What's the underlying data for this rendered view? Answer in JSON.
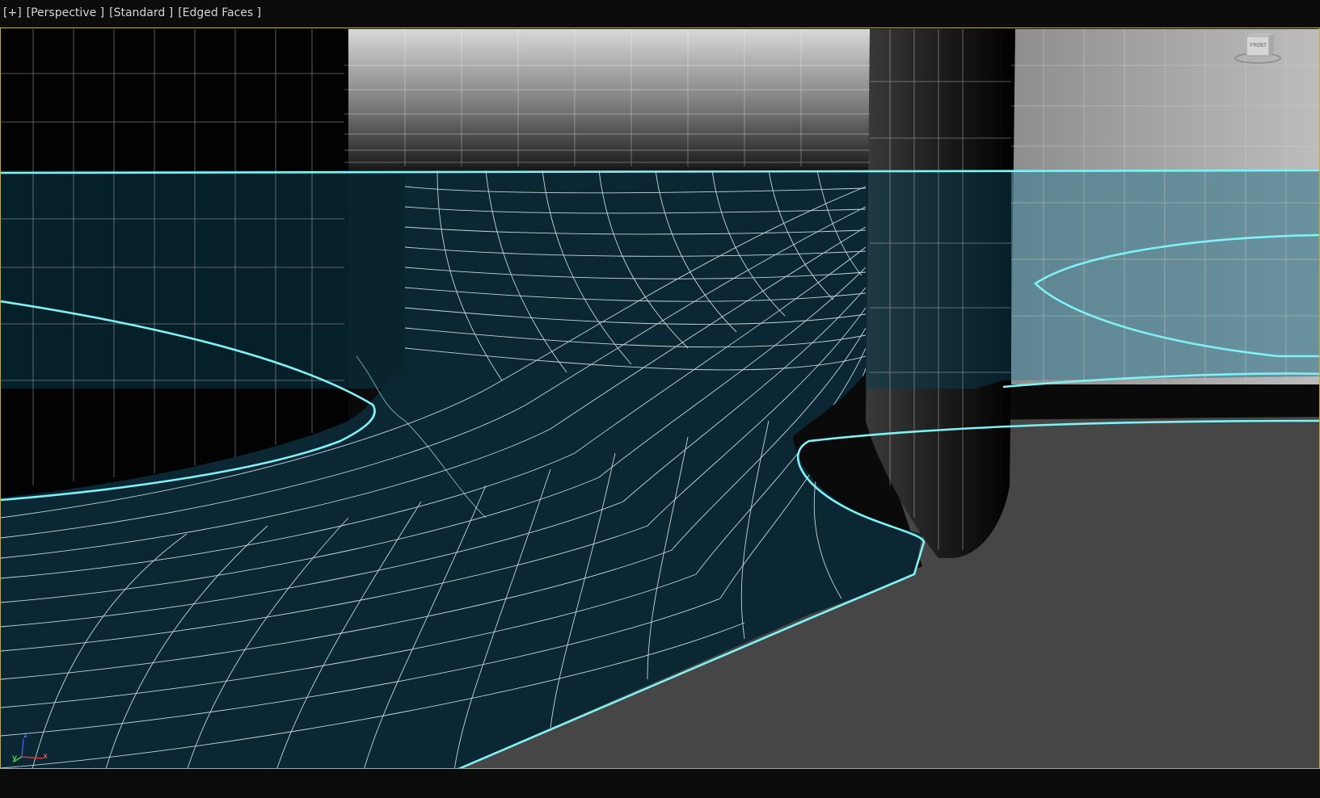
{
  "viewport": {
    "menu": {
      "plus": "[+]",
      "view": "[Perspective ]",
      "shading_mode": "[Standard ]",
      "display_mode": "[Edged Faces ]"
    },
    "viewcube": {
      "face_label": "FRONT"
    },
    "axis_gizmo": {
      "x": "x",
      "y": "y",
      "z": "z"
    }
  },
  "colors": {
    "selection_outline": "#7ff2f5",
    "wire": "#ffffff",
    "frame": "#b8a94a",
    "floor": "#464646",
    "selected_face": "#0a2733"
  }
}
